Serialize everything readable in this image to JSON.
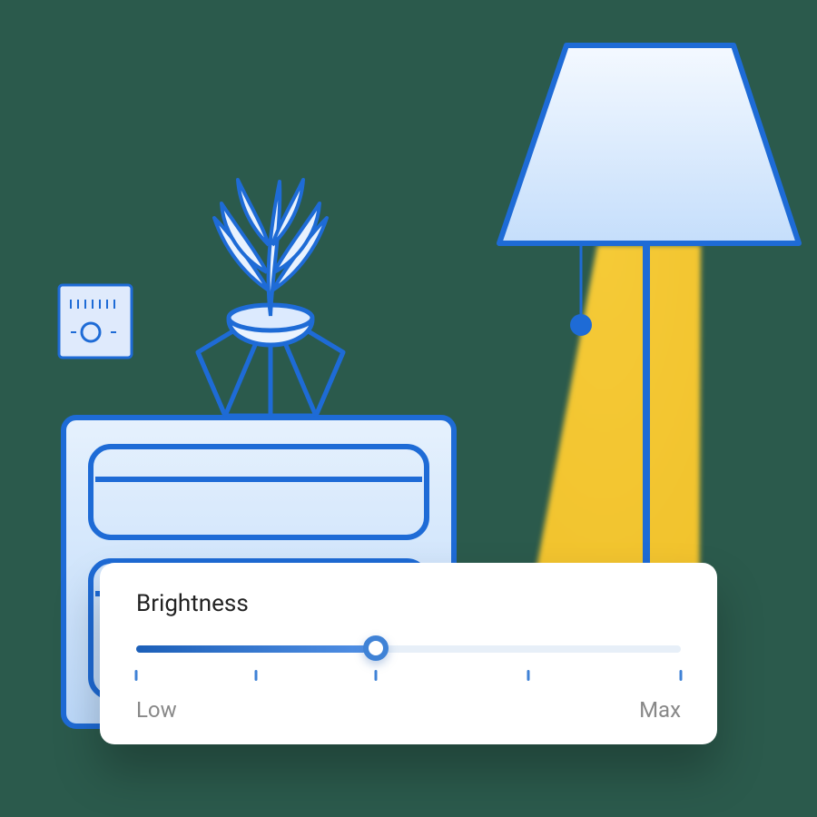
{
  "slider": {
    "title": "Brightness",
    "low_label": "Low",
    "max_label": "Max",
    "value_pct": 44,
    "tick_positions_pct": [
      0,
      22,
      44,
      72,
      100
    ]
  },
  "illustration": {
    "items": [
      "wall-switch",
      "plant",
      "dresser",
      "lamp",
      "light-glow"
    ]
  },
  "colors": {
    "bg": "#2B5A4C",
    "stroke": "#1e6bd6",
    "fill_light": "#d5e7fb",
    "fill_lighter": "#ecf4fd",
    "glow": "#f2c531"
  }
}
